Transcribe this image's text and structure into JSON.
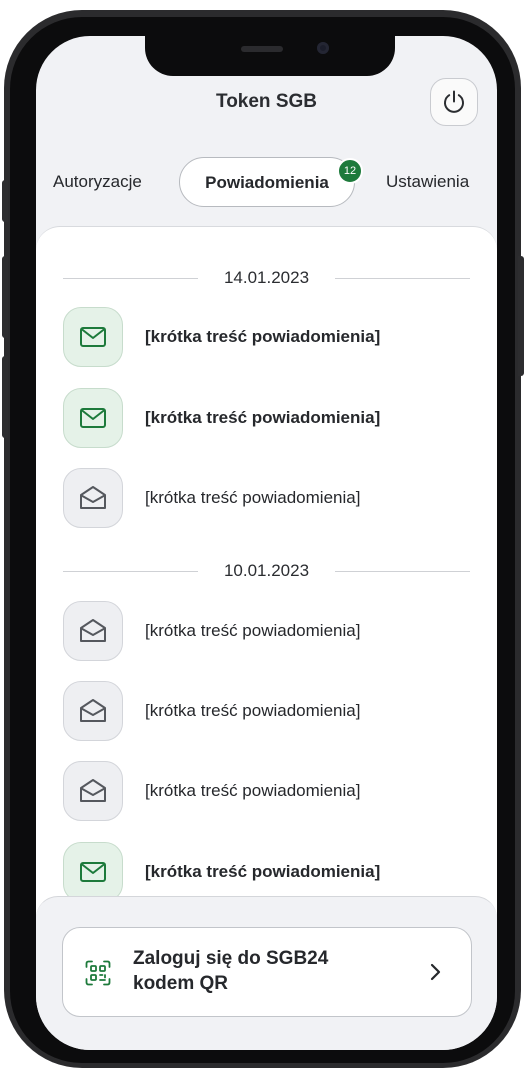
{
  "header": {
    "title": "Token SGB",
    "power_icon": "power-icon"
  },
  "tabs": [
    {
      "label": "Autoryzacje",
      "active": false
    },
    {
      "label": "Powiadomienia",
      "active": true,
      "badge": "12"
    },
    {
      "label": "Ustawienia",
      "active": false
    }
  ],
  "groups": [
    {
      "date": "14.01.2023",
      "items": [
        {
          "text": "[krótka treść powiadomienia]",
          "unread": true,
          "icon": "mail-closed-icon"
        },
        {
          "text": "[krótka treść powiadomienia]",
          "unread": true,
          "icon": "mail-closed-icon"
        },
        {
          "text": "[krótka treść powiadomienia]",
          "unread": false,
          "icon": "mail-open-icon"
        }
      ]
    },
    {
      "date": "10.01.2023",
      "items": [
        {
          "text": "[krótka treść powiadomienia]",
          "unread": false,
          "icon": "mail-open-icon"
        },
        {
          "text": "[krótka treść powiadomienia]",
          "unread": false,
          "icon": "mail-open-icon"
        },
        {
          "text": "[krótka treść powiadomienia]",
          "unread": false,
          "icon": "mail-open-icon"
        },
        {
          "text": "[krótka treść powiadomienia]",
          "unread": true,
          "icon": "mail-closed-icon"
        }
      ]
    }
  ],
  "qr_login": {
    "line1": "Zaloguj się do SGB24",
    "line2": "kodem QR",
    "icon": "qr-scan-icon",
    "chevron_icon": "chevron-right-icon"
  },
  "colors": {
    "accent": "#1d7a3b",
    "unread_bg": "#e5f2e8",
    "read_bg": "#eeeff2",
    "screen_bg": "#f1f2f5"
  }
}
